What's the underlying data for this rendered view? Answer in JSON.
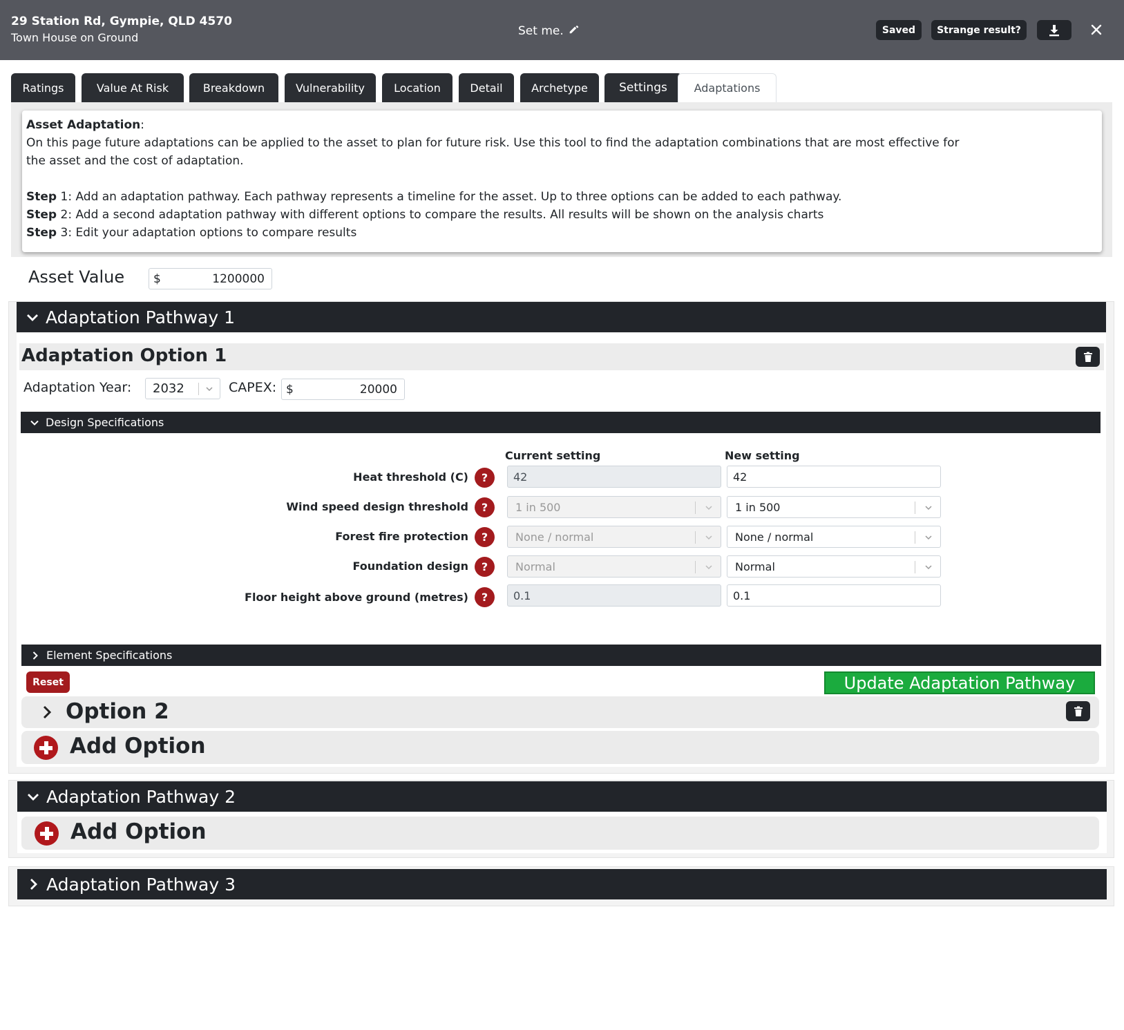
{
  "header": {
    "address": "29 Station Rd, Gympie, QLD 4570",
    "subtitle": "Town House on Ground",
    "set_me": "Set me.",
    "saved_label": "Saved",
    "strange_label": "Strange result?"
  },
  "tabs": [
    {
      "label": "Ratings"
    },
    {
      "label": "Value At Risk"
    },
    {
      "label": "Breakdown"
    },
    {
      "label": "Vulnerability"
    },
    {
      "label": "Location"
    },
    {
      "label": "Detail"
    },
    {
      "label": "Archetype"
    },
    {
      "label": "Settings"
    },
    {
      "label": "Adaptations",
      "active": true
    }
  ],
  "info": {
    "title": "Asset Adaptation",
    "intro_1": "On this page future adaptations can be applied to the asset to plan for future risk. Use this tool to find the adaptation combinations that are most effective for",
    "intro_2": "the asset and the cost of adaptation.",
    "step_label": "Step",
    "steps": [
      {
        "num": "1",
        "text": ": Add an adaptation pathway. Each pathway represents a timeline for the asset. Up to three options can be added to each pathway."
      },
      {
        "num": "2",
        "text": ": Add a second adaptation pathway with different options to compare the results. All results will be shown on the analysis charts"
      },
      {
        "num": "3",
        "text": ": Edit your adaptation options to compare results"
      }
    ]
  },
  "asset": {
    "label": "Asset Value",
    "currency": "$",
    "value": "1200000"
  },
  "pathway1": {
    "title": "Adaptation Pathway 1",
    "option1": {
      "title": "Adaptation Option 1",
      "year_label": "Adaptation Year:",
      "year": "2032",
      "capex_label": "CAPEX:",
      "capex_currency": "$",
      "capex": "20000",
      "design_title": "Design Specifications",
      "current_header": "Current setting",
      "new_header": "New setting",
      "rows": [
        {
          "label": "Heat threshold (C)",
          "current": "42",
          "new": "42"
        },
        {
          "label": "Wind speed design threshold",
          "current": "1 in 500",
          "new": "1 in 500"
        },
        {
          "label": "Forest fire protection",
          "current": "None / normal",
          "new": "None / normal"
        },
        {
          "label": "Foundation design",
          "current": "Normal",
          "new": "Normal"
        },
        {
          "label": "Floor height above ground (metres)",
          "current": "0.1",
          "new": "0.1"
        }
      ],
      "help_glyph": "?",
      "element_title": "Element Specifications",
      "reset_label": "Reset",
      "update_label": "Update Adaptation Pathway"
    },
    "option2_title": "Option 2",
    "add_option": "Add Option"
  },
  "pathway2": {
    "title": "Adaptation Pathway 2",
    "add_option": "Add Option"
  },
  "pathway3": {
    "title": "Adaptation Pathway 3"
  }
}
